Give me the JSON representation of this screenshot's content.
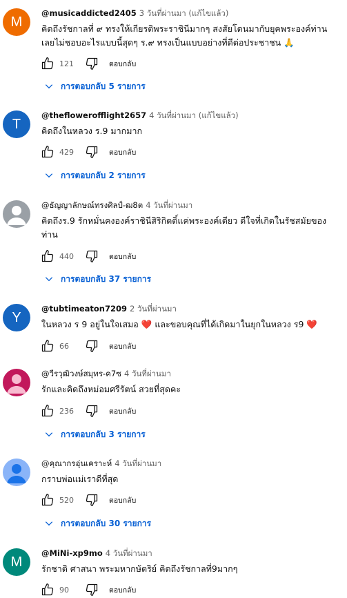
{
  "comments": [
    {
      "author": "@musicaddicted2405",
      "meta": "3 วันที่ผ่านมา (แก้ไขแล้ว)",
      "avatar_letter": "M",
      "avatar_color": "#ef6c00",
      "text": "คิดถึงรัชกาลที่ ๙ ทรงให้เกียรติพระราชินีมากๆ สงสัยโดนมากับยุคพระองค์ท่าน เลยไม่ชอบอะไรแบบนี้สุดๆ  ร.๙ ทรงเป็นแบบอย่างที่ดีต่อประชาชน 🙏",
      "likes": "121",
      "reply_label": "ตอบกลับ",
      "replies": "การตอบกลับ 5 รายการ"
    },
    {
      "author": "@theflowerofflight2657",
      "meta": "4 วันที่ผ่านมา (แก้ไขแล้ว)",
      "avatar_letter": "T",
      "avatar_color": "#1565c0",
      "text": "คิดถึงในหลวง ร.9 มากมาก",
      "likes": "429",
      "reply_label": "ตอบกลับ",
      "replies": "การตอบกลับ 2 รายการ"
    },
    {
      "author": "@ธัญญาลักษณ์ทรงศิลป์-ฒ8ต",
      "meta": "4 วันที่ผ่านมา",
      "avatar_letter": "",
      "avatar_color": "#9aa0a6",
      "text": "คิดถึงร.9 รักหมั่นคงองค์ราชินีสิริกิตติ์แค่พระองค์เดียว ดีใจที่เกิดในรัชสมัยของท่าน",
      "likes": "440",
      "reply_label": "ตอบกลับ",
      "replies": "การตอบกลับ 37 รายการ"
    },
    {
      "author": "@tubtimeaton7209",
      "meta": "2 วันที่ผ่านมา",
      "avatar_letter": "Y",
      "avatar_color": "#1565c0",
      "text": "ในหลวง ร 9 อยู่ในใจเสมอ ❤️ และขอบคุณที่ได้เกิดมาในยุกในหลวง ร9 ❤️",
      "likes": "66",
      "reply_label": "ตอบกลับ",
      "replies": ""
    },
    {
      "author": "@วีรวุฒิวงษ์สมุทร-ค7ซ",
      "meta": "4 วันที่ผ่านมา",
      "avatar_letter": "",
      "avatar_color": "#c2185b",
      "text": "รักและคิดถึงหม่อมศรีรัตน์  สวยที่สุดคะ",
      "likes": "236",
      "reply_label": "ตอบกลับ",
      "replies": "การตอบกลับ 3 รายการ"
    },
    {
      "author": "@คุณากรอุ่นเคราะห์",
      "meta": "4 วันที่ผ่านมา",
      "avatar_letter": "",
      "avatar_color": "#8ab4f8",
      "text": "กราบพ่อแม่เราดีที่สุด",
      "likes": "520",
      "reply_label": "ตอบกลับ",
      "replies": "การตอบกลับ 30 รายการ"
    },
    {
      "author": "@MiNi-xp9mo",
      "meta": "4 วันที่ผ่านมา",
      "avatar_letter": "M",
      "avatar_color": "#00897b",
      "text": "รักชาติ ศาสนา พระมหากษัตริย์ คิดถึงรัชกาลที่9มากๆ",
      "likes": "90",
      "reply_label": "ตอบกลับ",
      "replies": ""
    }
  ]
}
